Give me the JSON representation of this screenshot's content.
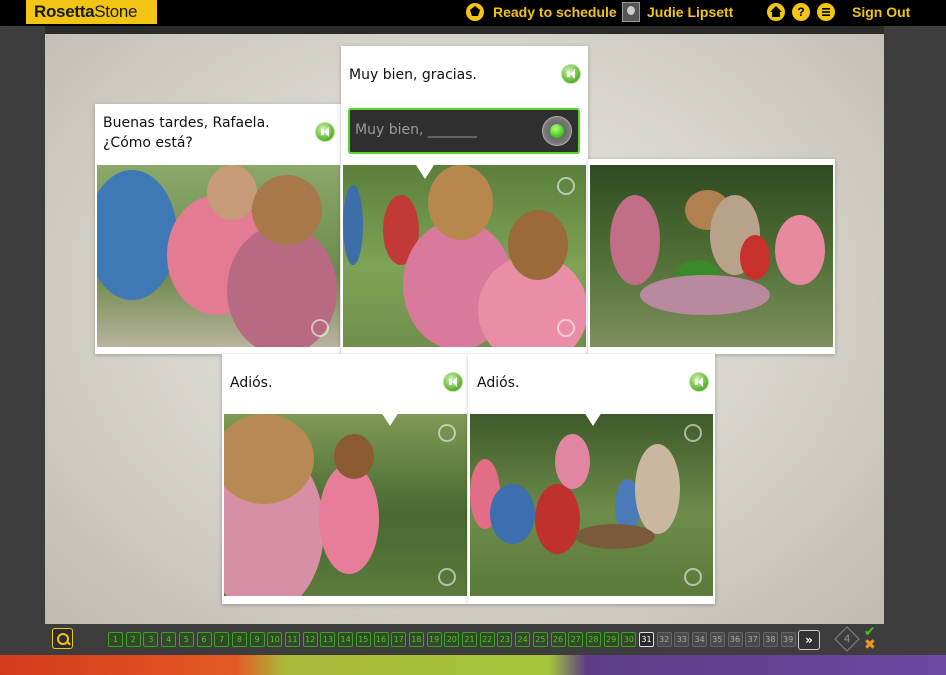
{
  "header": {
    "logo_part1": "Rosetta",
    "logo_part2": "Stone",
    "schedule_label": "Ready to schedule",
    "user_name": "Judie Lipsett",
    "help_glyph": "?",
    "signout_label": "Sign Out"
  },
  "lesson": {
    "cards": [
      {
        "caption_line1": "Buenas tardes, Rafaela.",
        "caption_line2": "¿Cómo está?"
      },
      {
        "caption_line1": "Muy bien, gracias."
      },
      {
        "caption_line1": "Adiós."
      },
      {
        "caption_line1": "Adiós."
      }
    ],
    "answer_placeholder": "Muy bien, _______"
  },
  "progress": {
    "pages": [
      "1",
      "2",
      "3",
      "4",
      "5",
      "6",
      "7",
      "8",
      "9",
      "10",
      "11",
      "12",
      "13",
      "14",
      "15",
      "16",
      "17",
      "18",
      "19",
      "20",
      "21",
      "22",
      "23",
      "24",
      "25",
      "26",
      "27",
      "28",
      "29",
      "30",
      "31",
      "32",
      "33",
      "34",
      "35",
      "36",
      "37",
      "38",
      "39"
    ],
    "current_page": 31,
    "next_glyph": "»",
    "score": "4",
    "check_glyph": "✔",
    "x_glyph": "✖"
  },
  "colors": {
    "brand_yellow": "#f2c414",
    "correct_green": "#3aa41e",
    "wrong_orange": "#f29b10"
  },
  "icons": [
    "home-icon",
    "help-icon",
    "menu-icon",
    "speaker-icon",
    "microphone-icon",
    "zoom-icon",
    "replay-icon"
  ]
}
